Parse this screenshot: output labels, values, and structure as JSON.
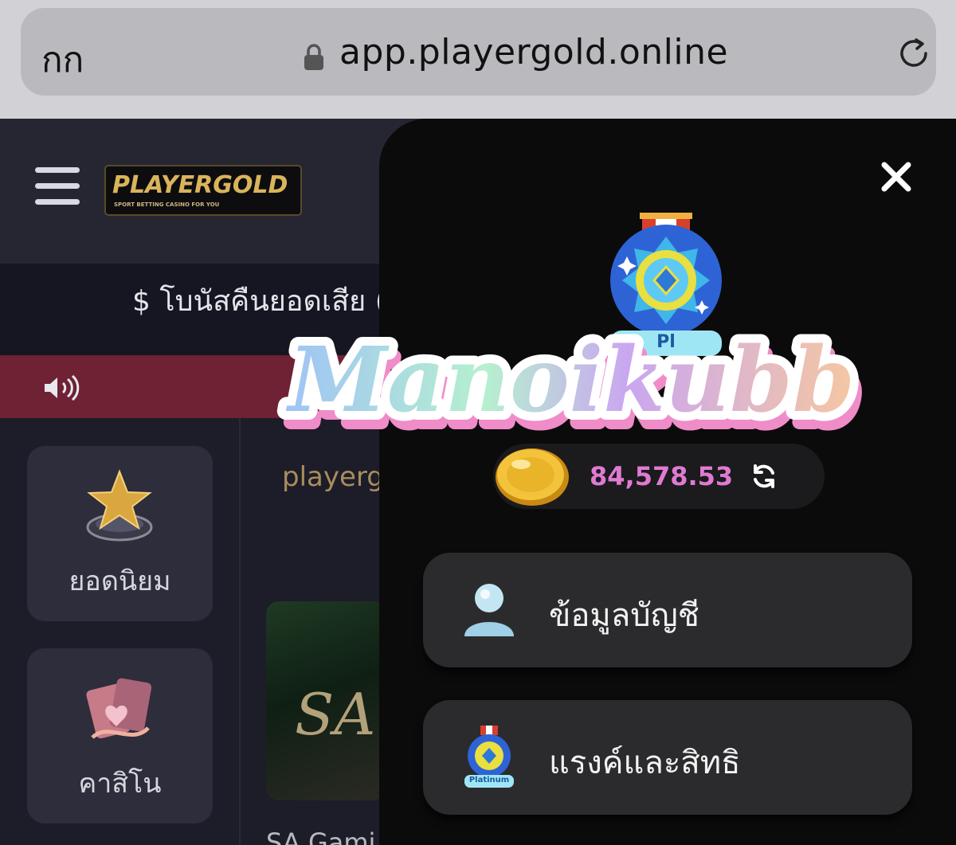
{
  "browser": {
    "text_size_label": "กก",
    "url": "app.playergold.online"
  },
  "header": {
    "logo_text": "PLAYERGOLD",
    "logo_tagline": "SPORT BETTING CASINO FOR YOU"
  },
  "bonus_bar": {
    "text": "$ โบนัสคืนยอดเสีย ("
  },
  "sidebar": {
    "tiles": [
      {
        "label": "ยอดนิยม",
        "icon": "star-chip-icon"
      },
      {
        "label": "คาสิโน",
        "icon": "playing-cards-icon"
      }
    ]
  },
  "main": {
    "provider_text": "playerg",
    "card_caption": "SA Gami",
    "card_logo": "SA"
  },
  "drawer": {
    "badge_label": "Pl",
    "balance": "84,578.53",
    "menu_items": [
      {
        "label": "ข้อมูลบัญชี",
        "icon": "user-icon"
      },
      {
        "label": "แรงค์และสิทธิ",
        "icon": "platinum-badge-icon",
        "badge_text": "Platinum"
      }
    ]
  },
  "watermark": {
    "text": "Manoikubb"
  },
  "colors": {
    "drawer_bg": "#0b0b0c",
    "balance": "#e07ad2",
    "announce_bar": "#6e2233",
    "logo_gold": "#d9b45a"
  }
}
